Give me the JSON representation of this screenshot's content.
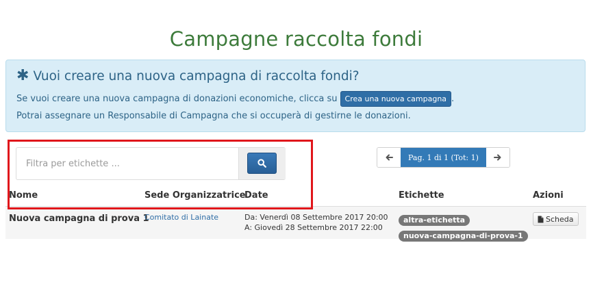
{
  "page": {
    "title": "Campagne raccolta fondi"
  },
  "info": {
    "heading": "Vuoi creare una nuova campagna di raccolta fondi?",
    "line1_text": "Se vuoi creare una nuova campagna di donazioni economiche, clicca su",
    "create_button": "Crea una nuova campagna",
    "line1_suffix": ".",
    "line2": "Potrai assegnare un Responsabile di Campagna che si occuperà di gestirne le donazioni."
  },
  "search": {
    "placeholder": "Filtra per etichette ..."
  },
  "pagination": {
    "label": "Pag. 1 di 1 (Tot: 1)"
  },
  "table": {
    "headers": [
      "Nome",
      "Sede Organizzatrice",
      "Date",
      "Etichette",
      "Azioni"
    ],
    "rows": [
      {
        "name": "Nuova campagna di prova 1",
        "sede": "Comitato di Lainate",
        "date_from": "Da: Venerdì 08 Settembre 2017 20:00",
        "date_to": "A: Giovedì 28 Settembre 2017 22:00",
        "tags": [
          "altra-etichetta",
          "nuova-campagna-di-prova-1"
        ],
        "action": "Scheda"
      }
    ]
  },
  "colors": {
    "title_green": "#3d7b3b",
    "info_bg": "#d9edf7",
    "primary": "#337ab7",
    "highlight_red": "#e0161b"
  },
  "icons": [
    "asterisk-icon",
    "search-icon",
    "arrow-left-icon",
    "arrow-right-icon",
    "file-icon"
  ]
}
